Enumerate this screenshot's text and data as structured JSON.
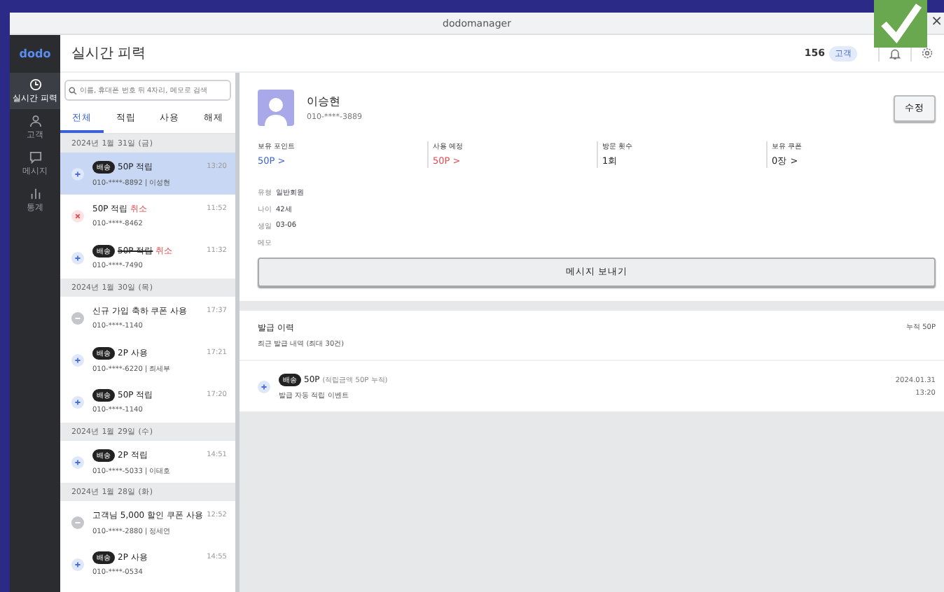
{
  "window": {
    "title": "dodomanager",
    "close": "×"
  },
  "sidebar": {
    "logo": "dodo",
    "items": [
      {
        "label": "실시간 피력",
        "selected": true
      },
      {
        "label": "고객",
        "selected": false
      },
      {
        "label": "메시지",
        "selected": false
      },
      {
        "label": "통계",
        "selected": false
      }
    ]
  },
  "header": {
    "title": "실시간 피력",
    "count": "156",
    "badge": "고객"
  },
  "search": {
    "placeholder": "이름, 휴대폰 번호 뒤 4자리, 메모로 검색"
  },
  "tabs": [
    {
      "label": "전체",
      "selected": true
    },
    {
      "label": "적립",
      "selected": false
    },
    {
      "label": "사용",
      "selected": false
    },
    {
      "label": "해제",
      "selected": false
    }
  ],
  "feed": [
    {
      "kind": "date",
      "label": "2024년 1월 31일 (금)"
    },
    {
      "kind": "earn",
      "tag": "배송",
      "title": "50P 적립",
      "strike": false,
      "sub": "010-****-8892 | 이성현",
      "time": "13:20",
      "selected": true
    },
    {
      "kind": "cancel",
      "title": "50P 적립",
      "suffix": "취소",
      "strike": false,
      "sub": "010-****-8462",
      "time": "11:52",
      "selected": false
    },
    {
      "kind": "earn",
      "tag": "배송",
      "title": "50P 적립",
      "suffix": "취소",
      "strike": true,
      "sub": "010-****-7490",
      "time": "11:32",
      "selected": false
    },
    {
      "kind": "date",
      "label": "2024년 1월 30일 (목)"
    },
    {
      "kind": "coupon",
      "title": "신규 가입 축하 쿠폰 사용",
      "strike": false,
      "sub": "010-****-1140",
      "time": "17:37",
      "selected": false
    },
    {
      "kind": "earn",
      "tag": "배송",
      "title": "2P 사용",
      "strike": false,
      "sub": "010-****-6220 | 최세부",
      "time": "17:21",
      "selected": false
    },
    {
      "kind": "earn",
      "tag": "배송",
      "title": "50P 적립",
      "strike": false,
      "sub": "010-****-1140",
      "time": "17:20",
      "selected": false
    },
    {
      "kind": "date",
      "label": "2024년 1월 29일 (수)"
    },
    {
      "kind": "earn",
      "tag": "배송",
      "title": "2P 적립",
      "strike": false,
      "sub": "010-****-5033 | 이태호",
      "time": "14:51",
      "selected": false
    },
    {
      "kind": "date",
      "label": "2024년 1월 28일 (화)"
    },
    {
      "kind": "coupon",
      "title": "고객님 5,000 할인 쿠폰 사용",
      "strike": false,
      "sub": "010-****-2880 | 정세연",
      "time": "12:52",
      "selected": false
    },
    {
      "kind": "earn",
      "tag": "배송",
      "title": "2P 사용",
      "strike": false,
      "sub": "010-****-0534",
      "time": "14:55",
      "selected": false
    }
  ],
  "profile": {
    "name": "이승현",
    "phone": "010-****-3889",
    "edit": "수정",
    "stats": [
      {
        "label": "보유 포인트",
        "value": "50P >",
        "color": "#3a62d4"
      },
      {
        "label": "사용 예정",
        "value": "50P >",
        "color": "#e5484d"
      },
      {
        "label": "방문 횟수",
        "value": "1회",
        "color": "#222222"
      },
      {
        "label": "보유 쿠폰",
        "value": "0장 >",
        "color": "#222222"
      }
    ],
    "info": [
      {
        "label": "유형",
        "value": "일반회원"
      },
      {
        "label": "나이",
        "value": "42세"
      },
      {
        "label": "생일",
        "value": "03-06"
      },
      {
        "label": "메모"
      }
    ],
    "message_button": "메시지 보내기"
  },
  "history": {
    "title": "발급 이력",
    "subtitle": "최근 발급 내역 (최대 30건)",
    "total": "누적 50P",
    "items": [
      {
        "tag": "배송",
        "title": "50P",
        "detail": "(적립금액 50P 누적)",
        "sub": "발급 자동 적립 이벤트",
        "date": "2024.01.31",
        "time": "13:20"
      }
    ]
  }
}
